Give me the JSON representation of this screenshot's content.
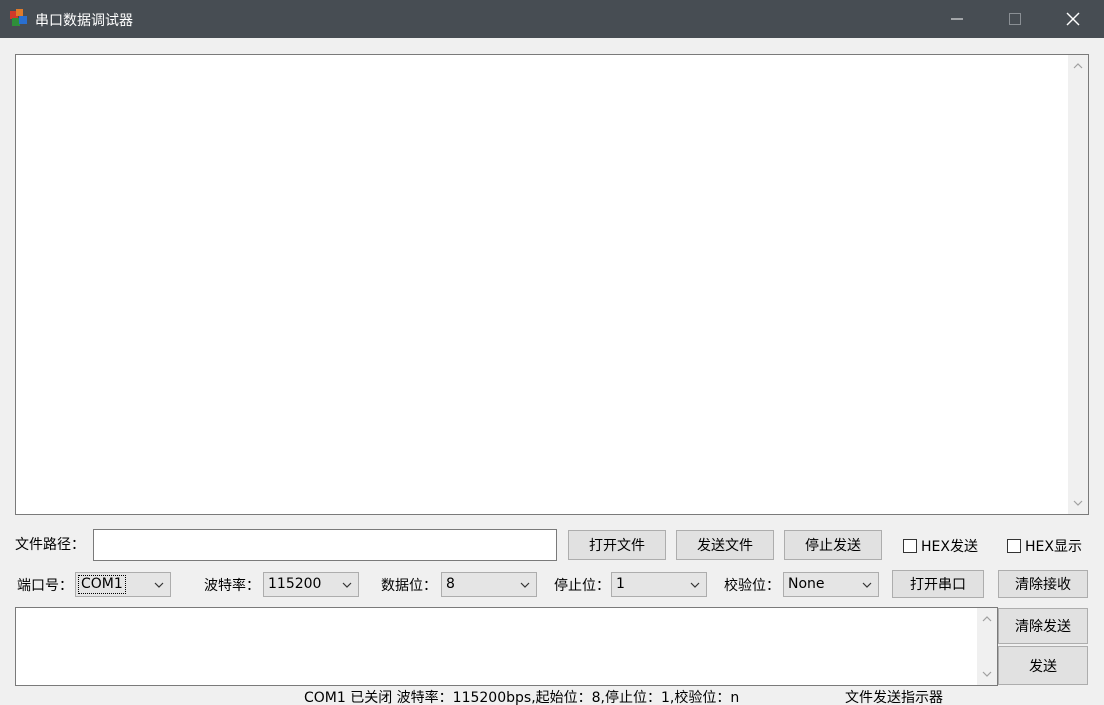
{
  "window": {
    "title": "串口数据调试器",
    "app_icon": "tricolor-cubes-icon",
    "controls": [
      "minimize-icon",
      "maximize-icon",
      "close-icon"
    ]
  },
  "file_row": {
    "path_label": "文件路径：",
    "path_value": "",
    "open_file": "打开文件",
    "send_file": "发送文件",
    "stop_send": "停止发送",
    "hex_send": {
      "label": "HEX发送",
      "checked": false
    },
    "hex_display": {
      "label": "HEX显示",
      "checked": false
    }
  },
  "port_row": {
    "port_label": "端口号：",
    "port_value": "COM1",
    "baud_label": "波特率：",
    "baud_value": "115200",
    "data_bits_label": "数据位：",
    "data_bits_value": "8",
    "stop_bits_label": "停止位：",
    "stop_bits_value": "1",
    "parity_label": "校验位：",
    "parity_value": "None",
    "open_port": "打开串口",
    "clear_receive": "清除接收"
  },
  "send_panel": {
    "clear_send": "清除发送",
    "send": "发送",
    "send_value": ""
  },
  "status": {
    "port_status": "COM1 已关闭 波特率：115200bps,起始位：8,停止位：1,校验位：n",
    "file_indicator": "文件发送指示器"
  },
  "colors": {
    "titlebar": "#474d53",
    "window_bg": "#f0f0f0",
    "button_bg": "#e1e1e1",
    "button_border": "#adadad"
  }
}
